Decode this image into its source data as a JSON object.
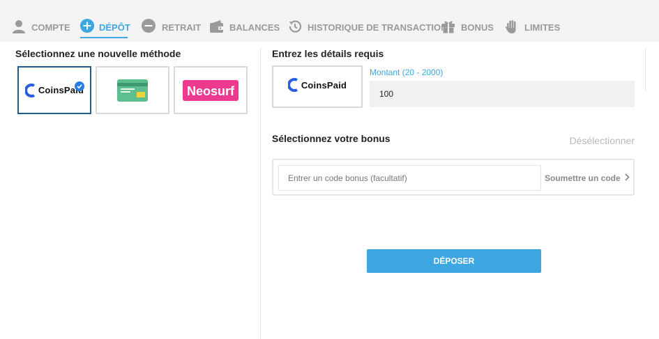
{
  "nav": {
    "tabs": [
      {
        "label": "COMPTE",
        "icon": "user-icon",
        "active": false
      },
      {
        "label": "DÉPÔT",
        "icon": "plus-circle-icon",
        "active": true
      },
      {
        "label": "RETRAIT",
        "icon": "minus-circle-icon",
        "active": false
      },
      {
        "label": "BALANCES",
        "icon": "wallet-icon",
        "active": false
      },
      {
        "label": "HISTORIQUE DE TRANSACTION",
        "icon": "history-icon",
        "active": false
      },
      {
        "label": "BONUS",
        "icon": "gift-icon",
        "active": false
      },
      {
        "label": "LIMITES",
        "icon": "hand-icon",
        "active": false
      }
    ]
  },
  "left": {
    "title": "Sélectionnez une nouvelle méthode",
    "methods": [
      {
        "name": "CoinsPaid",
        "selected": true
      },
      {
        "name": "card",
        "selected": false
      },
      {
        "name": "Neosurf",
        "selected": false
      }
    ]
  },
  "right": {
    "title": "Entrez les détails requis",
    "method_logo": "CoinsPaid",
    "amount_label": "Montant (20 - 2000)",
    "amount_value": "100",
    "bonus_title": "Sélectionnez votre bonus",
    "deselect_label": "Désélectionner",
    "bonus_placeholder": "Entrer un code bonus (facultatif)",
    "submit_code_label": "Soumettre un code",
    "deposit_label": "DÉPOSER"
  },
  "colors": {
    "accent": "#3ea6e0",
    "inactive_tab": "#9a9a9a",
    "selected_border": "#1e5a8e",
    "neosurf": "#ec3a8e",
    "card_green": "#5dbf8e",
    "coinspaid_blue": "#2a5de0"
  }
}
